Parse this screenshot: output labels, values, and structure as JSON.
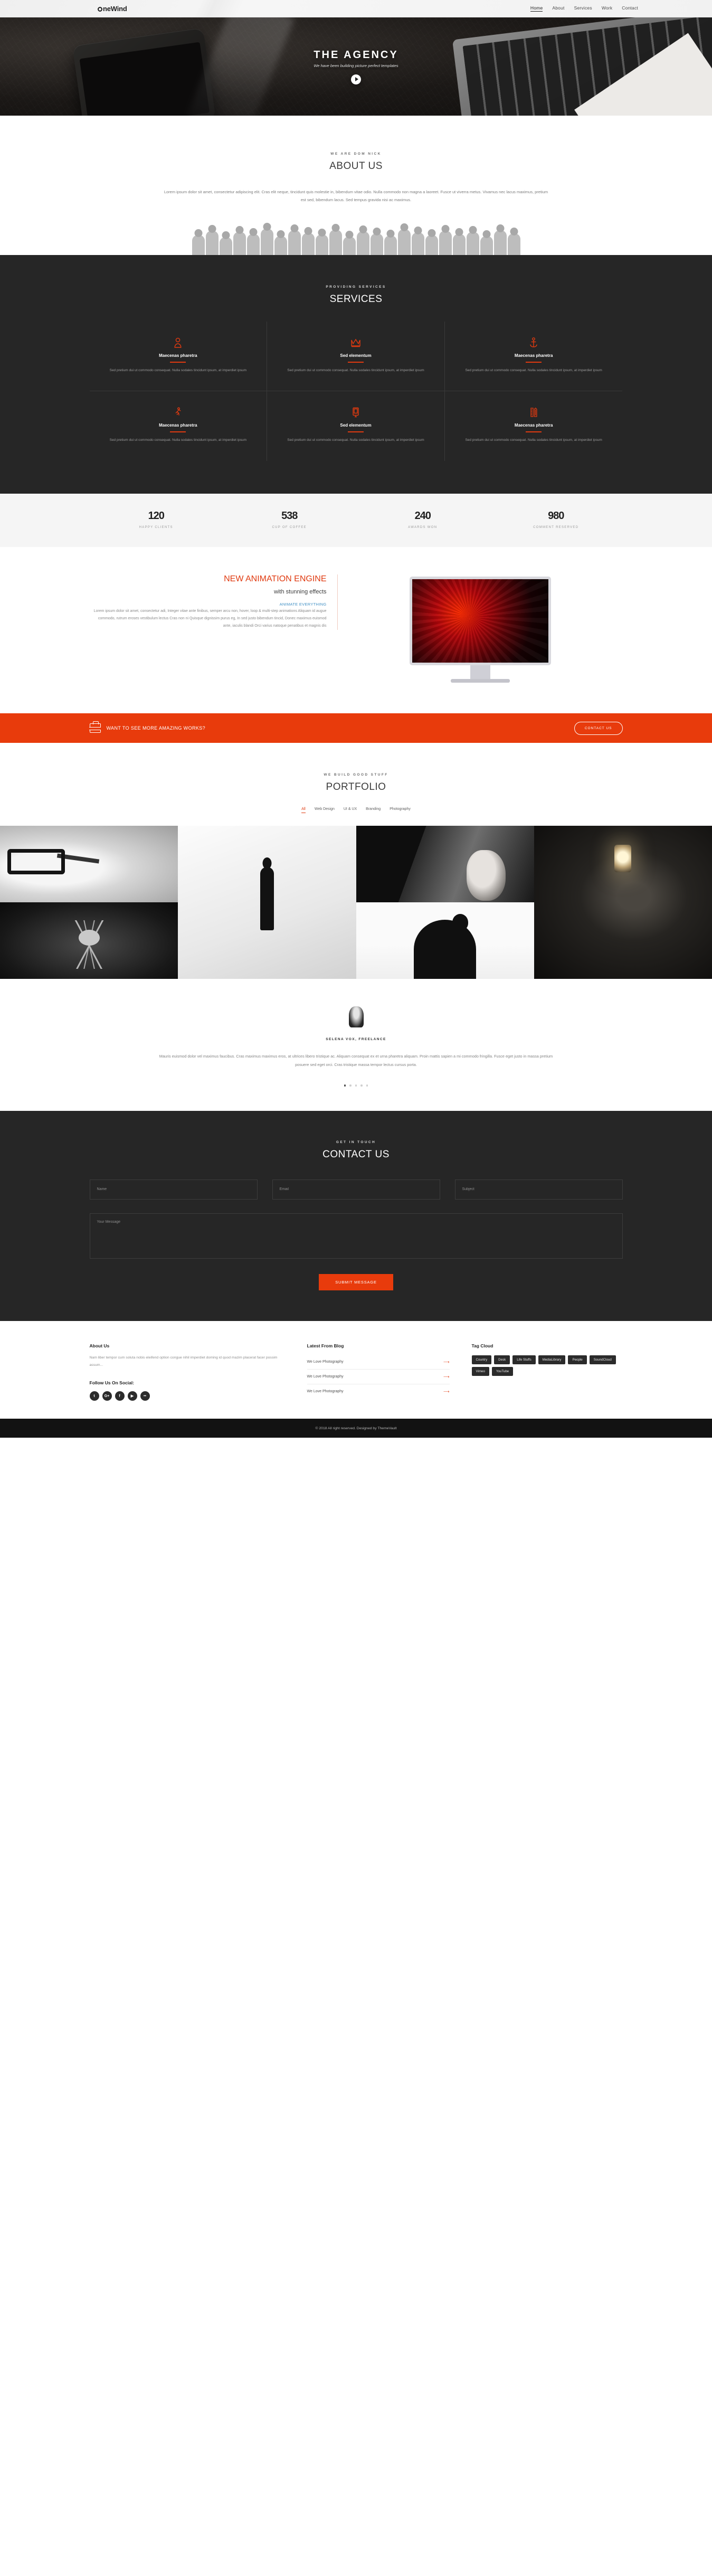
{
  "header": {
    "brand": "neWind",
    "brand_prefix": "O",
    "nav": [
      {
        "label": "Home",
        "active": true
      },
      {
        "label": "About",
        "active": false
      },
      {
        "label": "Services",
        "active": false
      },
      {
        "label": "Work",
        "active": false
      },
      {
        "label": "Contact",
        "active": false
      }
    ]
  },
  "hero": {
    "title": "THE AGENCY",
    "subtitle": "We have been building picture perfect templates",
    "play_icon": "play-icon"
  },
  "about": {
    "eyebrow": "WE ARE DOM NICK",
    "title": "ABOUT US",
    "body": "Lorem ipsum dolor sit amet, consectetur adipiscing elit. Cras elit neque, tincidunt quis molestie in, bibendum vitae odio. Nulla commodo non magna a laoreet. Fusce ut viverra metus. Vivamus nec lacus maximus, pretium est sed, bibendum lacus. Sed tempus gravida nisi ac maximus."
  },
  "services": {
    "eyebrow": "PROVIDING SERVICES",
    "title": "SERVICES",
    "items": [
      {
        "icon": "user-icon",
        "title": "Maecenas pharetra",
        "text": "Sed pretium dui ut commodo consequat. Nulla sodales tincidunt ipsum, at imperdiet ipsum"
      },
      {
        "icon": "crown-icon",
        "title": "Sed elementum",
        "text": "Sed pretium dui ut commodo consequat. Nulla sodales tincidunt ipsum, at imperdiet ipsum"
      },
      {
        "icon": "anchor-icon",
        "title": "Maecenas pharetra",
        "text": "Sed pretium dui ut commodo consequat. Nulla sodales tincidunt ipsum, at imperdiet ipsum"
      },
      {
        "icon": "running-man-icon",
        "title": "Maecenas pharetra",
        "text": "Sed pretium dui ut commodo consequat. Nulla sodales tincidunt ipsum, at imperdiet ipsum"
      },
      {
        "icon": "tablet-icon",
        "title": "Sed elementum",
        "text": "Sed pretium dui ut commodo consequat. Nulla sodales tincidunt ipsum, at imperdiet ipsum"
      },
      {
        "icon": "ruler-pencil-icon",
        "title": "Maecenas pharetra",
        "text": "Sed pretium dui ut commodo consequat. Nulla sodales tincidunt ipsum, at imperdiet ipsum"
      }
    ]
  },
  "counters": [
    {
      "num": "120",
      "label": "HAPPY CLIENTS"
    },
    {
      "num": "538",
      "label": "CUP OF COFFEE"
    },
    {
      "num": "240",
      "label": "AWARDS WON"
    },
    {
      "num": "980",
      "label": "COMMENT RESERVED"
    }
  ],
  "animation": {
    "title": "NEW ANIMATION ENGINE",
    "subtitle": "with stunning effects",
    "highlight": "ANIMATE EVERYTHING",
    "body": "Lorem ipsum dolor sit amet, consectetur adi, Integer vitae ante finibus, semper arcu non, hover, loop & multi-step animations Aliquam id augue commodo, rutrum eroses vestibulum lectus Cras non ni Quisque dignissim purus eg, In sed justo bibendum tincid, Donec maximus euismod ante, iaculis blandi Orci varius natoque penatibus et magnis dis"
  },
  "cta": {
    "icon": "briefcase-icon",
    "text": "WANT TO SEE MORE AMAZING WORKS?",
    "button": "CONTACT US"
  },
  "portfolio": {
    "eyebrow": "WE BUILD GOOD STUFF",
    "title": "PORTFOLIO",
    "filters": [
      {
        "label": "All",
        "active": true
      },
      {
        "label": "Web Design",
        "active": false
      },
      {
        "label": "UI & UX",
        "active": false
      },
      {
        "label": "Branding",
        "active": false
      },
      {
        "label": "Photography",
        "active": false
      }
    ]
  },
  "testimonial": {
    "avatar": "avatar",
    "author": "SELENA VOX, FREELANCE",
    "quote": "Mauris euismod dolor vel maximus faucibus. Cras maximus maximus eros, at ultrices libero tristique ac. Aliquam consequat ex et urna pharetra aliquam. Proin mattis sapien a mi commodo fringilla. Fusce eget justo in massa pretium posuere sed eget orci. Cras tristique massa tempor lectus cursus porta.",
    "dots": 5,
    "active_dot": 1
  },
  "contact": {
    "eyebrow": "GET IN TOUCH",
    "title": "CONTACT US",
    "name_placeholder": "Name",
    "email_placeholder": "Email",
    "subject_placeholder": "Subject",
    "message_placeholder": "Your Message",
    "submit": "SUBMIT MESSAGE"
  },
  "footer": {
    "about_title": "About Us",
    "about_text": "Nam liber tempor cum soluta nobis eleifend option congue nihil imperdiet doming id quod mazim placerat facer possim assum...",
    "social_title": "Follow Us On Social:",
    "socials": [
      {
        "icon": "twitter-icon",
        "glyph": "t"
      },
      {
        "icon": "google-plus-icon",
        "glyph": "G+"
      },
      {
        "icon": "facebook-icon",
        "glyph": "f"
      },
      {
        "icon": "youtube-icon",
        "glyph": "▶"
      },
      {
        "icon": "flickr-icon",
        "glyph": "••"
      }
    ],
    "blog_title": "Latest From Blog",
    "blog_items": [
      "We Love Photography",
      "We Love Photography",
      "We Love Photography"
    ],
    "blog_arrow": "⟶",
    "tag_title": "Tag Cloud",
    "tags": [
      "Country",
      "Desk",
      "Life Stuffs",
      "MediaLibrary",
      "People",
      "SoundCloud",
      "Vimeo",
      "YouTube"
    ],
    "copyright": "© 2018 All right reserved. Designed by ThemeVault"
  }
}
